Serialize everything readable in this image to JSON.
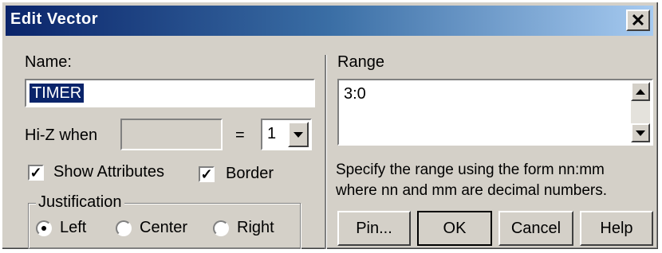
{
  "window": {
    "title": "Edit Vector",
    "close_glyph": "✕"
  },
  "name": {
    "label": "Name:",
    "value": "TIMER"
  },
  "hiz": {
    "label": "Hi-Z when",
    "value": "",
    "equals": "=",
    "select_value": "1"
  },
  "checks": {
    "show_attributes": {
      "label": "Show Attributes",
      "checked": true
    },
    "border": {
      "label": "Border",
      "checked": true
    }
  },
  "justification": {
    "legend": "Justification",
    "options": [
      {
        "label": "Left",
        "selected": true
      },
      {
        "label": "Center",
        "selected": false
      },
      {
        "label": "Right",
        "selected": false
      }
    ]
  },
  "range": {
    "label": "Range",
    "value": "3:0",
    "help_line1": "Specify the range using the form nn:mm",
    "help_line2": "where nn and mm are decimal numbers."
  },
  "buttons": {
    "pin": "Pin...",
    "ok": "OK",
    "cancel": "Cancel",
    "help": "Help"
  },
  "check_glyph": "✓",
  "colors": {
    "title_gradient_start": "#0a246a",
    "title_gradient_end": "#a6caf0",
    "face": "#d4d0c8"
  }
}
